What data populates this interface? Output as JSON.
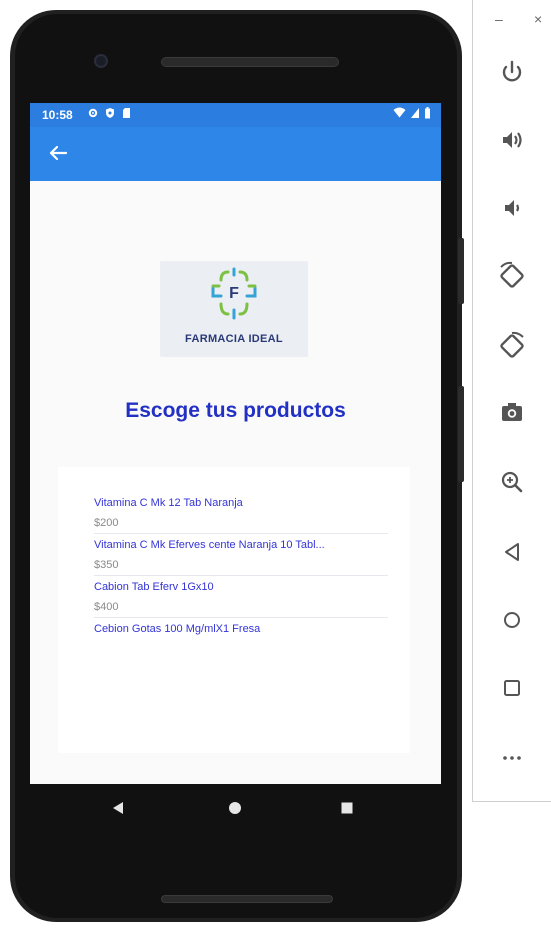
{
  "status_bar": {
    "time": "10:58",
    "left_icons": [
      "gear-icon",
      "shield-icon",
      "sd-card-icon"
    ],
    "right_icons": [
      "wifi-icon",
      "signal-icon",
      "battery-icon"
    ]
  },
  "app_bar": {
    "back_icon": "arrow-left-icon"
  },
  "logo": {
    "text": "FARMACIA IDEAL",
    "center_letter": "F"
  },
  "heading": "Escoge tus productos",
  "products": [
    {
      "name": "Vitamina C Mk 12 Tab Naranja",
      "price": "$200"
    },
    {
      "name": "Vitamina C Mk Eferves cente Naranja 10 Tabl...",
      "price": "$350"
    },
    {
      "name": "Cabion Tab Eferv 1Gx10",
      "price": "$400"
    },
    {
      "name": "Cebion Gotas 100 Mg/mlX1 Fresa",
      "price": ""
    }
  ],
  "nav_bar": [
    "back-triangle-icon",
    "home-circle-icon",
    "overview-square-icon"
  ],
  "emulator_panel": {
    "window_controls": {
      "minimize": "–",
      "close": "×"
    },
    "tools": [
      "power-icon",
      "volume-up-icon",
      "volume-down-icon",
      "rotate-left-icon",
      "rotate-right-icon",
      "camera-icon",
      "zoom-icon",
      "back-icon",
      "home-icon",
      "overview-icon",
      "more-icon"
    ]
  },
  "colors": {
    "status_bar": "#2b7de0",
    "app_bar": "#2e86e8",
    "heading": "#2230c4",
    "product_name": "#3434d6",
    "product_price": "#8a8a8a",
    "logo_green": "#7cc143",
    "logo_blue": "#34a3d6",
    "logo_text": "#2a3a78"
  }
}
